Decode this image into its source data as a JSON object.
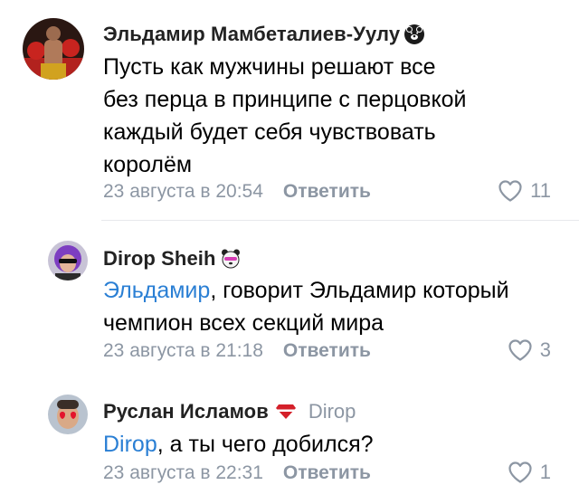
{
  "comments": [
    {
      "author": "Эльдамир Мамбеталиев-Уулу",
      "badge_icon": "bear-icon",
      "text_lines": [
        "Пусть как мужчины решают все",
        "без перца в принципе с перцовкой",
        "каждый будет себя чувствовать",
        "королём"
      ],
      "date": "23 августа в 20:54",
      "reply_label": "Ответить",
      "likes": "11"
    },
    {
      "author": "Dirop Sheih",
      "badge_icon": "panda-icon",
      "mention": "Эльдамир",
      "text_first_rest": ", говорит Эльдамир который",
      "text_second_line": "чемпион всех секций мира",
      "date": "23 августа в 21:18",
      "reply_label": "Ответить",
      "likes": "3"
    },
    {
      "author": "Руслан Исламов",
      "badge_icon": "spartak-logo-icon",
      "reply_to": "Dirop",
      "mention": "Dirop",
      "text_rest": ", а ты чего добился?",
      "date": "23 августа в 22:31",
      "reply_label": "Ответить",
      "likes": "1"
    }
  ],
  "colors": {
    "mention": "#2a7fd4",
    "secondary": "#8c96a3"
  }
}
